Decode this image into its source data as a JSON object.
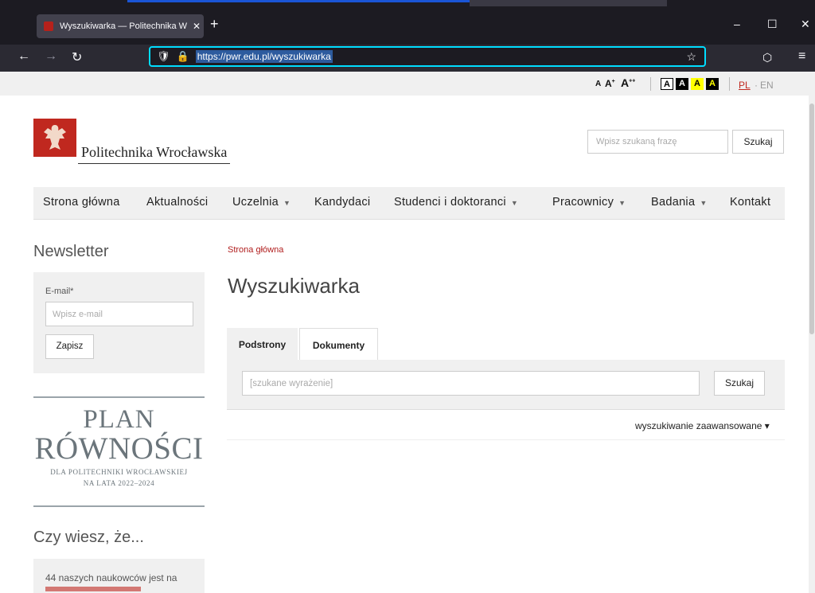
{
  "browser": {
    "tab_title": "Wyszukiwarka — Politechnika W",
    "tab_close": "✕",
    "new_tab": "+",
    "url": "https://pwr.edu.pl/wyszukiwarka",
    "window_min": "–",
    "window_max": "☐",
    "window_close": "✕",
    "nav_back": "←",
    "nav_forward": "→",
    "nav_reload": "↻",
    "pocket": "⬡",
    "menu": "≡"
  },
  "accessibility": {
    "font_small": "A",
    "font_medium": "A",
    "font_medium_sup": "+",
    "font_large": "A",
    "font_large_sup": "++",
    "contrast": [
      "A",
      "A",
      "A",
      "A"
    ],
    "lang_pl": "PL",
    "lang_sep": "·",
    "lang_en": "EN"
  },
  "header": {
    "logo_text": "Politechnika Wrocławska",
    "search_placeholder": "Wpisz szukaną frazę",
    "search_button": "Szukaj"
  },
  "menu": {
    "items": [
      {
        "label": "Strona główna"
      },
      {
        "label": "Aktualności"
      },
      {
        "label": "Uczelnia"
      },
      {
        "label": "Kandydaci"
      },
      {
        "label": "Studenci i doktoranci"
      },
      {
        "label": "Pracownicy"
      },
      {
        "label": "Badania"
      },
      {
        "label": "Kontakt"
      }
    ]
  },
  "sidebar": {
    "newsletter_title": "Newsletter",
    "email_label": "E-mail*",
    "email_placeholder": "Wpisz e-mail",
    "subscribe_button": "Zapisz",
    "plan_line1": "PLAN",
    "plan_line2": "RÓWNOŚCI",
    "plan_line3": "DLA POLITECHNIKI WROCŁAWSKIEJ",
    "plan_line4": "NA LATA 2022–2024",
    "fact_title": "Czy wiesz, że...",
    "fact_text": "44 naszych naukowców jest na"
  },
  "main": {
    "breadcrumb": "Strona główna",
    "title": "Wyszukiwarka",
    "tabs": [
      {
        "label": "Podstrony"
      },
      {
        "label": "Dokumenty"
      }
    ],
    "search_placeholder": "[szukane wyrażenie]",
    "search_button": "Szukaj",
    "advanced": "wyszukiwanie zaawansowane ▾"
  },
  "colors": {
    "brand_red": "#c0281f",
    "url_focus": "#00ddff"
  }
}
